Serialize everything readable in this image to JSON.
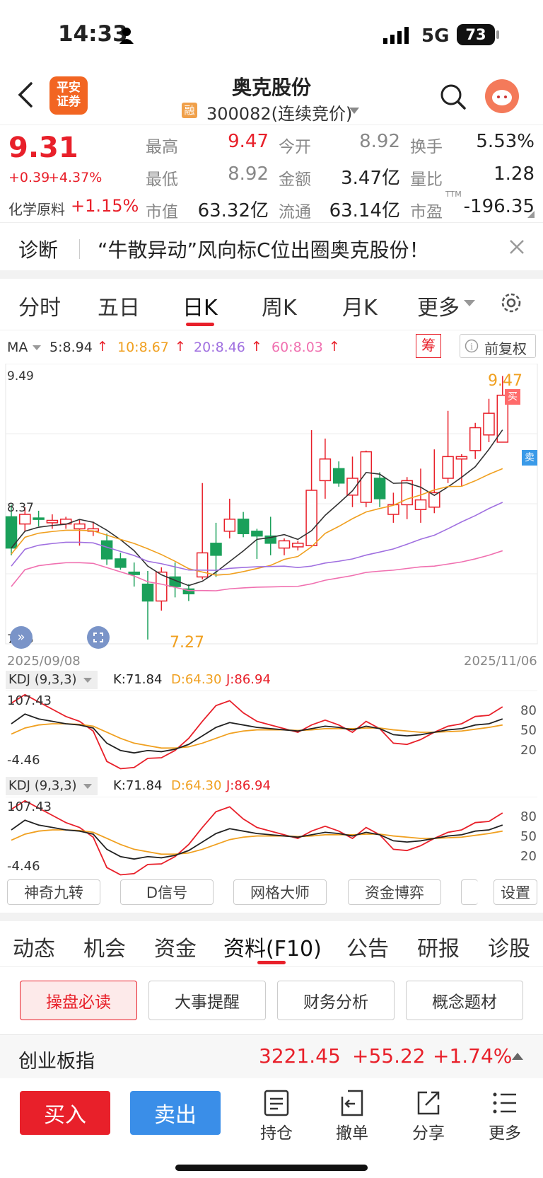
{
  "status": {
    "time": "14:33",
    "network": "5G",
    "battery": "73"
  },
  "header": {
    "broker_logo": "平安\n证券",
    "title": "奥克股份",
    "rong": "融",
    "code": "300082(连续竞价)"
  },
  "quote": {
    "price": "9.31",
    "change": "+0.39",
    "pct": "+4.37%",
    "sector": "化学原料",
    "sector_pct": "+1.15%",
    "high_lbl": "最高",
    "high": "9.47",
    "open_lbl": "今开",
    "open": "8.92",
    "turn_lbl": "换手",
    "turn": "5.53%",
    "low_lbl": "最低",
    "low": "8.92",
    "amt_lbl": "金额",
    "amt": "3.47亿",
    "vr_lbl": "量比",
    "vr": "1.28",
    "mcap_lbl": "市值",
    "mcap": "63.32亿",
    "float_lbl": "流通",
    "float": "63.14亿",
    "pe_lbl": "市盈",
    "pe_sup": "TTM",
    "pe": "-196.35"
  },
  "diag": {
    "label": "诊断",
    "text": "“牛散异动”风向标C位出圈奥克股份！"
  },
  "chart_tabs": [
    "分时",
    "五日",
    "日K",
    "周K",
    "月K",
    "更多"
  ],
  "ma": {
    "label": "MA",
    "ma5": "5:8.94",
    "ma10": "10:8.67",
    "ma20": "20:8.46",
    "ma60": "60:8.03",
    "chou": "筹",
    "fuquan": "前复权"
  },
  "chart_labels": {
    "top": "9.49",
    "mid": "8.37",
    "bottom": "7.25",
    "max_mark": "9.47",
    "min_mark": "7.27",
    "date_start": "2025/09/08",
    "date_end": "2025/11/06",
    "buy": "买",
    "sell": "卖"
  },
  "kdj1": {
    "label": "KDJ (9,3,3)",
    "k": "K:71.84",
    "d": "D:64.30",
    "j": "J:86.94",
    "top": "107.43",
    "bottom": "-4.46",
    "r80": "80",
    "r50": "50",
    "r20": "20"
  },
  "kdj2": {
    "label": "KDJ (9,3,3)",
    "k": "K:71.84",
    "d": "D:64.30",
    "j": "J:86.94",
    "top": "107.43",
    "bottom": "-4.46",
    "r80": "80",
    "r50": "50",
    "r20": "20"
  },
  "indicator_btns": [
    "神奇九转",
    "D信号",
    "网格大师",
    "资金博弈",
    "设置"
  ],
  "info_tabs": [
    "动态",
    "机会",
    "资金",
    "资料(F10)",
    "公告",
    "研报",
    "诊股"
  ],
  "f10_btns": [
    "操盘必读",
    "大事提醒",
    "财务分析",
    "概念题材"
  ],
  "index_bar": {
    "name": "创业板指",
    "value": "3221.45",
    "change": "+55.22",
    "pct": "+1.74%"
  },
  "bottom": {
    "buy": "买入",
    "sell": "卖出",
    "hold": "持仓",
    "cancel": "撤单",
    "share": "分享",
    "more": "更多"
  },
  "chart_data": {
    "type": "candlestick",
    "ylim": [
      7.25,
      9.49
    ],
    "x_range": [
      "2025/09/08",
      "2025/11/06"
    ],
    "ohlc": [
      [
        8.3,
        8.4,
        7.98,
        8.04
      ],
      [
        8.24,
        8.38,
        8.18,
        8.32
      ],
      [
        8.29,
        8.35,
        8.22,
        8.28
      ],
      [
        8.25,
        8.32,
        8.2,
        8.27
      ],
      [
        8.24,
        8.3,
        8.2,
        8.28
      ],
      [
        8.2,
        8.28,
        8.06,
        8.24
      ],
      [
        8.18,
        8.26,
        8.14,
        8.2
      ],
      [
        8.1,
        8.16,
        7.9,
        7.95
      ],
      [
        7.95,
        8.0,
        7.86,
        7.88
      ],
      [
        7.84,
        7.92,
        7.72,
        7.82
      ],
      [
        7.74,
        7.85,
        7.28,
        7.6
      ],
      [
        7.6,
        7.88,
        7.52,
        7.84
      ],
      [
        7.8,
        7.92,
        7.63,
        7.72
      ],
      [
        7.7,
        7.74,
        7.6,
        7.66
      ],
      [
        7.8,
        8.58,
        7.78,
        8.0
      ],
      [
        8.08,
        8.25,
        7.8,
        7.98
      ],
      [
        8.18,
        8.45,
        8.12,
        8.28
      ],
      [
        8.28,
        8.34,
        8.13,
        8.16
      ],
      [
        8.18,
        8.2,
        7.95,
        8.14
      ],
      [
        8.14,
        8.3,
        7.98,
        8.08
      ],
      [
        8.04,
        8.12,
        7.98,
        8.1
      ],
      [
        8.05,
        8.1,
        8.02,
        8.08
      ],
      [
        8.06,
        9.02,
        8.05,
        8.52
      ],
      [
        8.6,
        8.95,
        8.45,
        8.78
      ],
      [
        8.7,
        8.76,
        8.55,
        8.58
      ],
      [
        8.48,
        8.8,
        8.38,
        8.62
      ],
      [
        8.42,
        8.85,
        8.38,
        8.84
      ],
      [
        8.62,
        8.67,
        8.38,
        8.45
      ],
      [
        8.32,
        8.5,
        8.25,
        8.4
      ],
      [
        8.4,
        8.63,
        8.28,
        8.6
      ],
      [
        8.36,
        8.7,
        8.25,
        8.44
      ],
      [
        8.38,
        8.86,
        8.33,
        8.5
      ],
      [
        8.62,
        9.18,
        8.58,
        8.8
      ],
      [
        8.78,
        8.82,
        8.55,
        8.8
      ],
      [
        8.85,
        9.08,
        8.78,
        9.04
      ],
      [
        8.98,
        9.28,
        8.92,
        9.16
      ],
      [
        8.92,
        9.47,
        8.92,
        9.31
      ]
    ],
    "series": [
      {
        "name": "MA5",
        "color": "#333333"
      },
      {
        "name": "MA10",
        "color": "#f0a020"
      },
      {
        "name": "MA20",
        "color": "#a070e0"
      },
      {
        "name": "MA60",
        "color": "#f070b0"
      }
    ]
  }
}
